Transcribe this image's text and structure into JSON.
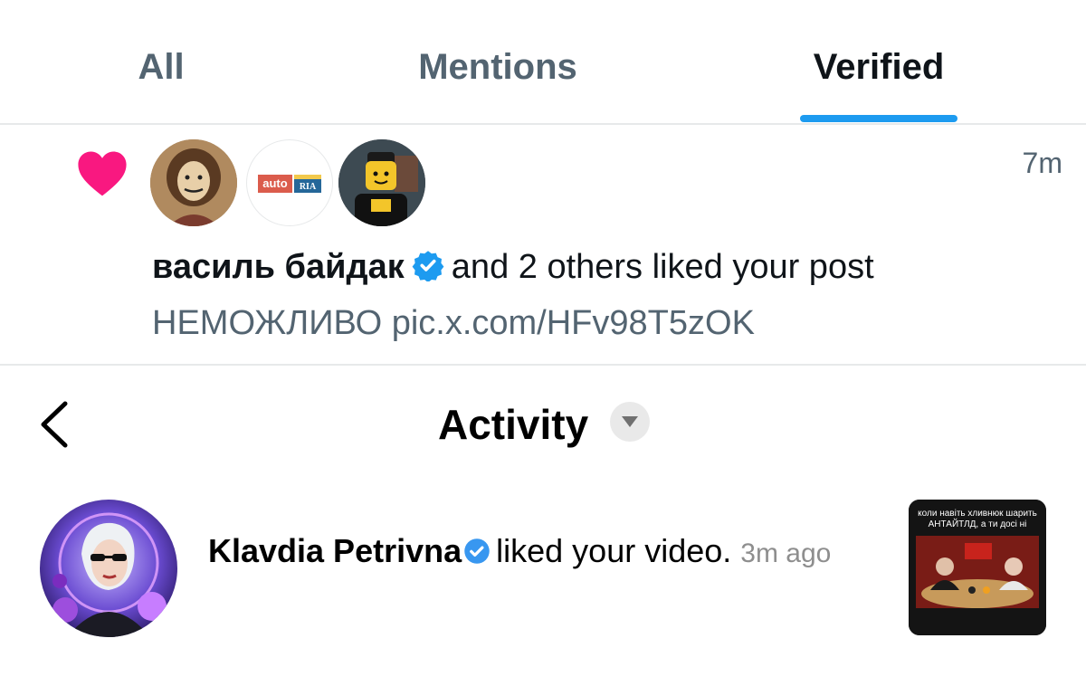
{
  "tabs": [
    {
      "label": "All"
    },
    {
      "label": "Mentions"
    },
    {
      "label": "Verified",
      "active": true
    }
  ],
  "notification": {
    "icon": "heart-icon",
    "time": "7m",
    "user_name": "василь байдак",
    "verified": true,
    "summary": "and 2 others liked your post",
    "post_text": "НЕМОЖЛИВО pic.x.com/HFv98T5zOK",
    "avatars": [
      "avatar-portrait",
      "avatar-autoria-logo",
      "avatar-lego-figure"
    ],
    "logo_text": {
      "word": "auto",
      "badge": "RIA"
    }
  },
  "activity": {
    "title": "Activity",
    "back_icon": "chevron-left-icon",
    "dropdown_icon": "chevron-down-icon",
    "item": {
      "user_name": "Klavdia Petrivna",
      "verified": true,
      "action": "liked your video.",
      "time": "3m ago",
      "thumbnail_caption": [
        "коли навіть хливнюк шарить",
        "АНТАЙТЛД, а ти досі ні"
      ]
    }
  },
  "colors": {
    "accent": "#1d9bf0",
    "heart": "#f91880",
    "muted": "#536471"
  }
}
